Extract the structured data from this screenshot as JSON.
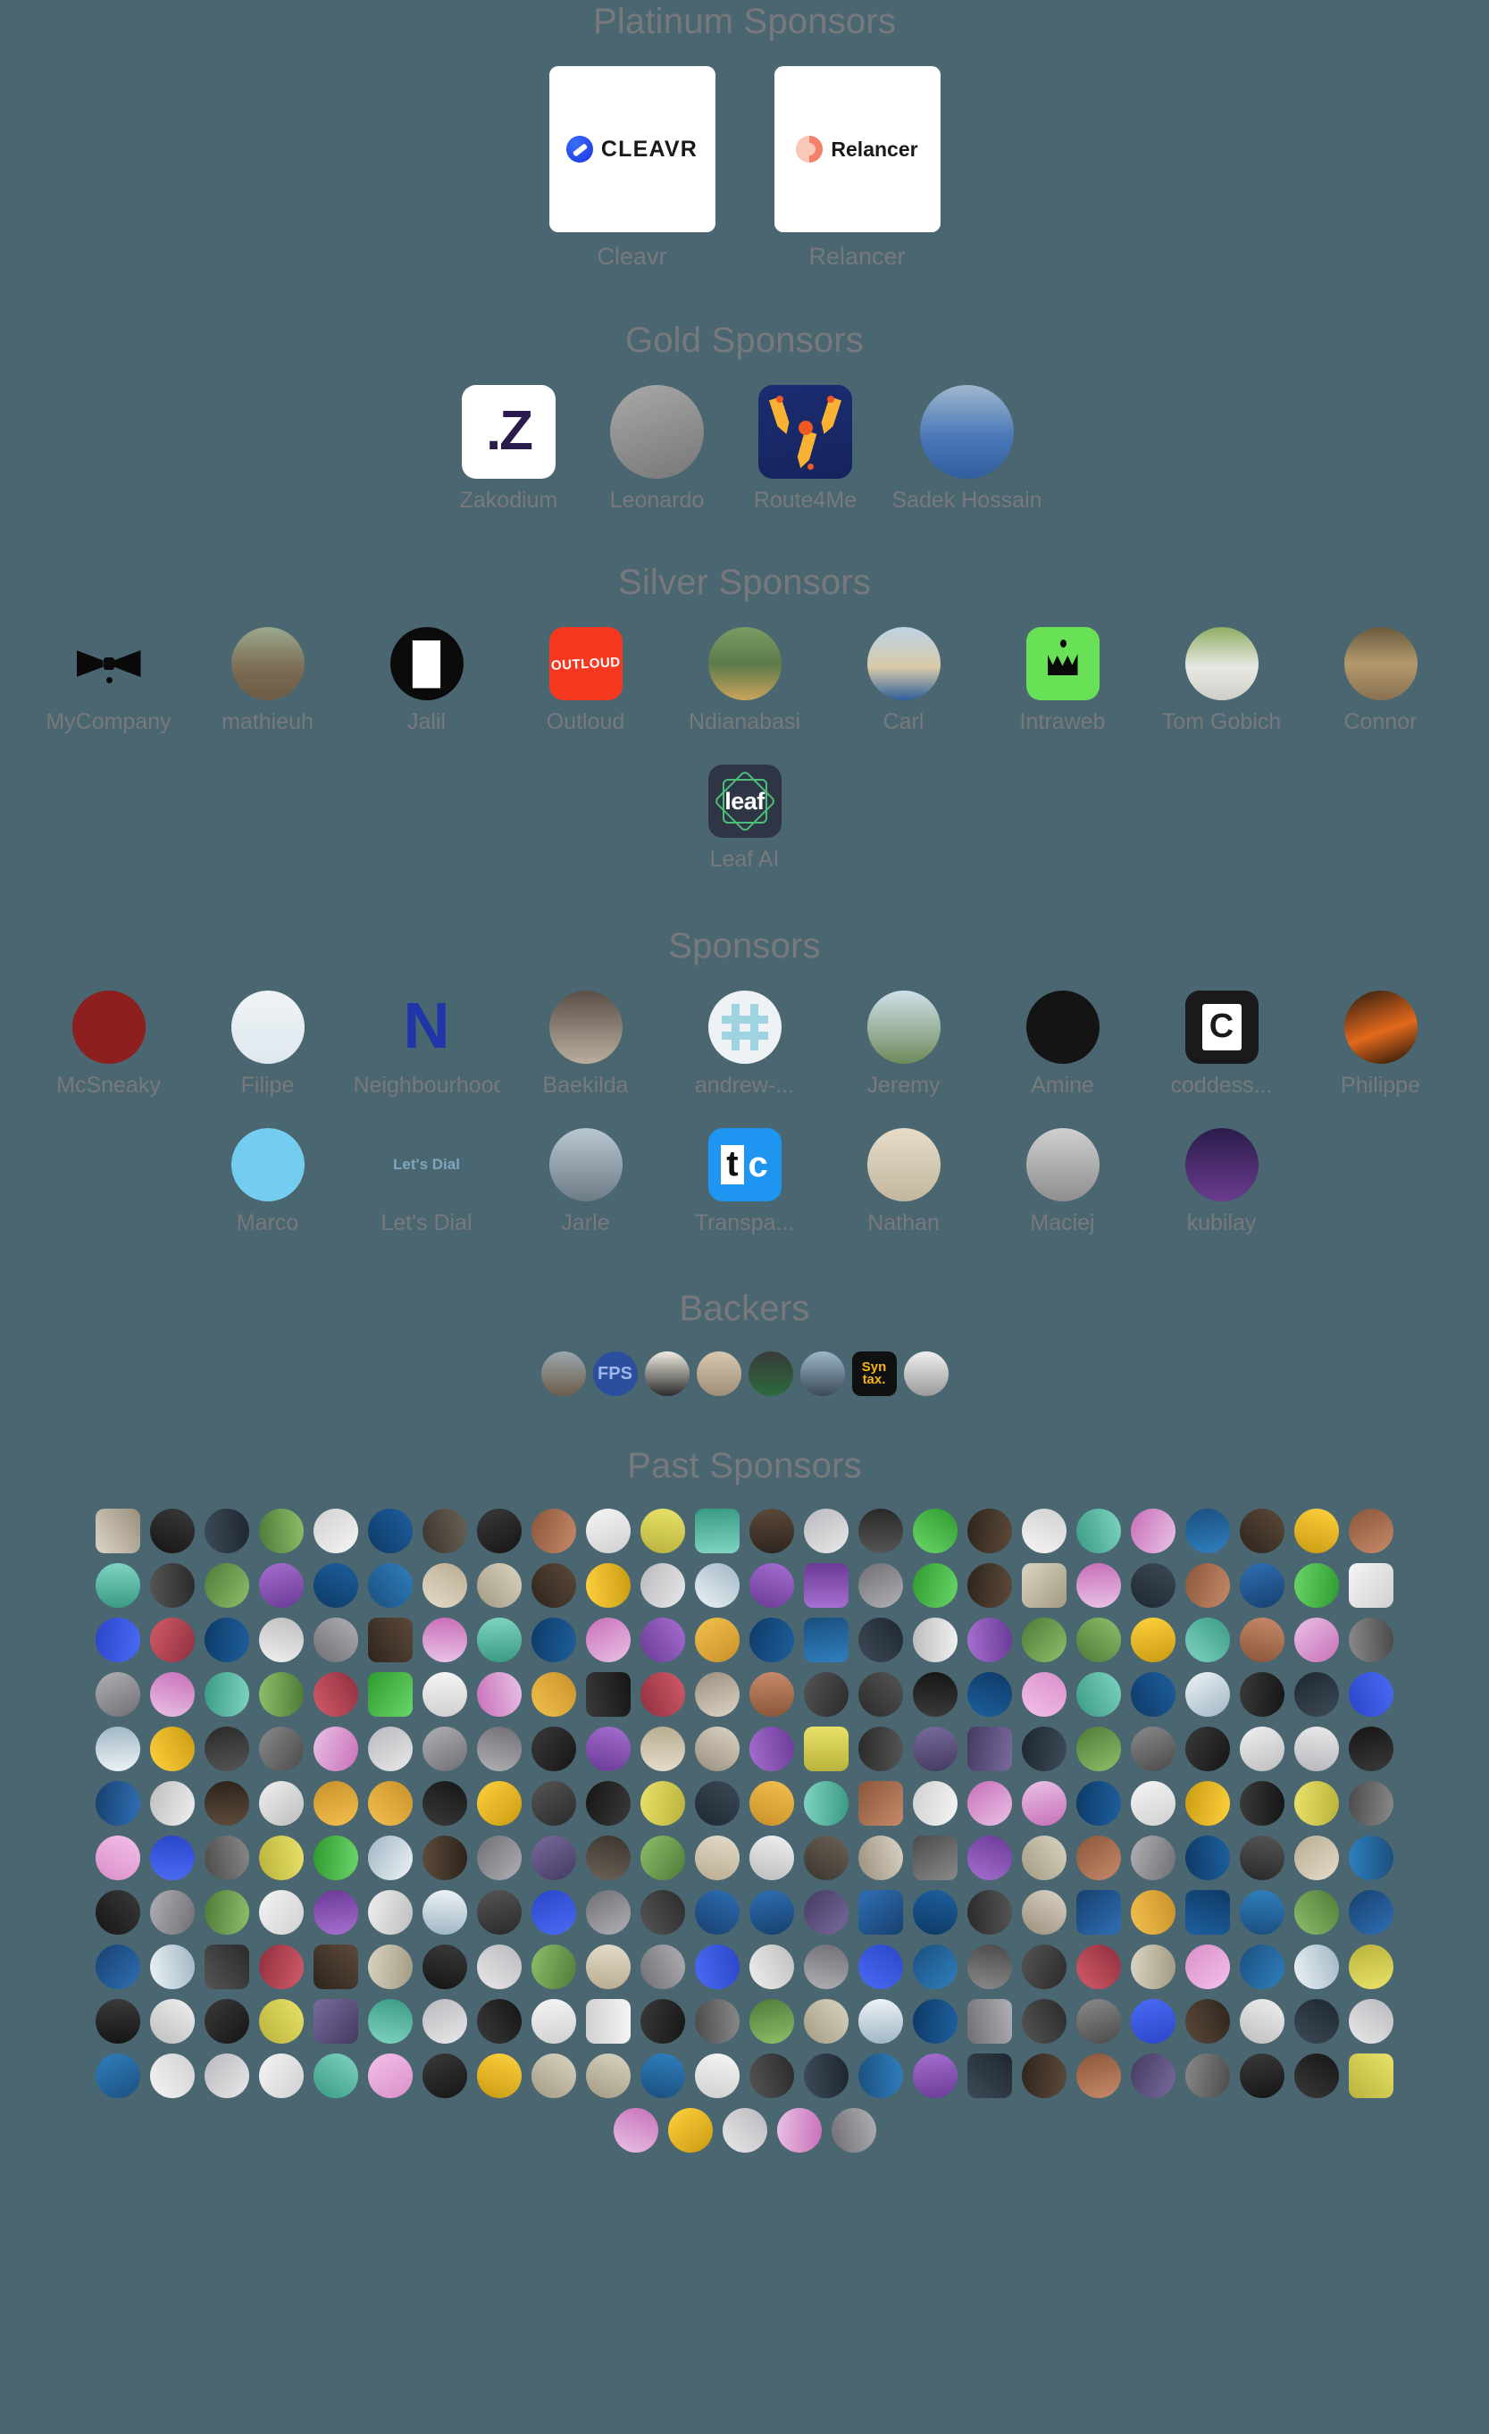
{
  "theme": {
    "background": "#4a6670",
    "heading_color": "#78797c",
    "label_color": "#78797c",
    "card_background": "#ffffff"
  },
  "sections": {
    "platinum": {
      "title": "Platinum Sponsors",
      "items": [
        {
          "label": "Cleavr",
          "wordmark": "CLEAVR",
          "mark": "cleavr-mark-icon"
        },
        {
          "label": "Relancer",
          "wordmark": "Relancer",
          "mark": "relancer-mark-icon"
        }
      ]
    },
    "gold": {
      "title": "Gold Sponsors",
      "items": [
        {
          "label": "Zakodium",
          "glyph": ".Z"
        },
        {
          "label": "Leonardo",
          "glyph": ""
        },
        {
          "label": "Route4Me",
          "glyph": ""
        },
        {
          "label": "Sadek Hossain",
          "glyph": ""
        }
      ]
    },
    "silver": {
      "title": "Silver Sponsors",
      "items": [
        {
          "label": "MyCompany",
          "glyph": ""
        },
        {
          "label": "mathieuh",
          "glyph": ""
        },
        {
          "label": "Jalil",
          "glyph": ""
        },
        {
          "label": "Outloud",
          "glyph": "OUTLOUD"
        },
        {
          "label": "Ndianabasi",
          "glyph": ""
        },
        {
          "label": "Carl",
          "glyph": ""
        },
        {
          "label": "Intraweb",
          "glyph": ""
        },
        {
          "label": "Tom Gobich",
          "glyph": ""
        },
        {
          "label": "Connor",
          "glyph": ""
        },
        {
          "label": "Leaf AI",
          "glyph": "leaf"
        }
      ]
    },
    "sponsors": {
      "title": "Sponsors",
      "items": [
        {
          "label": "McSneaky",
          "glyph": ""
        },
        {
          "label": "Filipe",
          "glyph": ""
        },
        {
          "label": "Neighbourhoodie",
          "glyph": "N"
        },
        {
          "label": "Baekilda",
          "glyph": ""
        },
        {
          "label": "andrew-...",
          "glyph": ""
        },
        {
          "label": "Jeremy",
          "glyph": ""
        },
        {
          "label": "Amine",
          "glyph": ""
        },
        {
          "label": "coddess...",
          "glyph": "C"
        },
        {
          "label": "Philippe",
          "glyph": ""
        },
        {
          "label": "Marco",
          "glyph": ""
        },
        {
          "label": "Let's Dial",
          "glyph": "Let's Dial"
        },
        {
          "label": "Jarle",
          "glyph": ""
        },
        {
          "label": "Transpa...",
          "glyph": "tc"
        },
        {
          "label": "Nathan",
          "glyph": ""
        },
        {
          "label": "Maciej",
          "glyph": ""
        },
        {
          "label": "kubilay",
          "glyph": ""
        }
      ]
    },
    "backers": {
      "title": "Backers",
      "count": 8,
      "items": [
        {
          "glyph": ""
        },
        {
          "glyph": "FPS"
        },
        {
          "glyph": ""
        },
        {
          "glyph": ""
        },
        {
          "glyph": ""
        },
        {
          "glyph": ""
        },
        {
          "glyph": "Syn tax."
        },
        {
          "glyph": ""
        }
      ]
    },
    "past": {
      "title": "Past Sponsors",
      "columns": 24,
      "full_rows": 11,
      "last_row_count": 5,
      "total": 269
    }
  }
}
